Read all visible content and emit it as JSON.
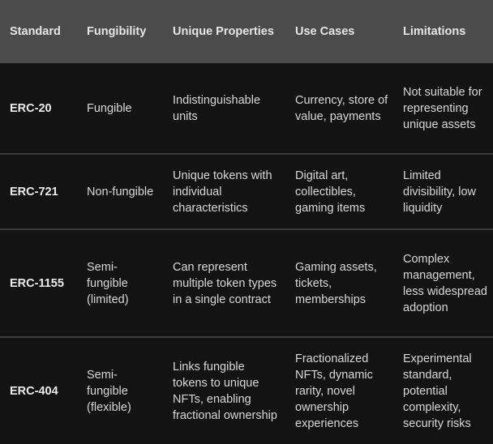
{
  "table": {
    "headers": [
      "Standard",
      "Fungibility",
      "Unique Properties",
      "Use Cases",
      "Limitations"
    ],
    "rows": [
      {
        "standard": "ERC-20",
        "fungibility": "Fungible",
        "unique_properties": "Indistinguishable units",
        "use_cases": "Currency, store of value, payments",
        "limitations": "Not suitable for representing unique assets"
      },
      {
        "standard": "ERC-721",
        "fungibility": "Non-fungible",
        "unique_properties": "Unique tokens with individual characteristics",
        "use_cases": "Digital art, collectibles, gaming items",
        "limitations": "Limited divisibility, low liquidity"
      },
      {
        "standard": "ERC-1155",
        "fungibility": "Semi-fungible (limited)",
        "unique_properties": "Can represent multiple token types in a single contract",
        "use_cases": "Gaming assets, tickets, memberships",
        "limitations": "Complex management, less widespread adoption"
      },
      {
        "standard": "ERC-404",
        "fungibility": "Semi-fungible (flexible)",
        "unique_properties": "Links fungible tokens to unique NFTs, enabling fractional ownership",
        "use_cases": "Fractionalized NFTs, dynamic rarity, novel ownership experiences",
        "limitations": "Experimental standard, potential complexity, security risks"
      }
    ]
  }
}
